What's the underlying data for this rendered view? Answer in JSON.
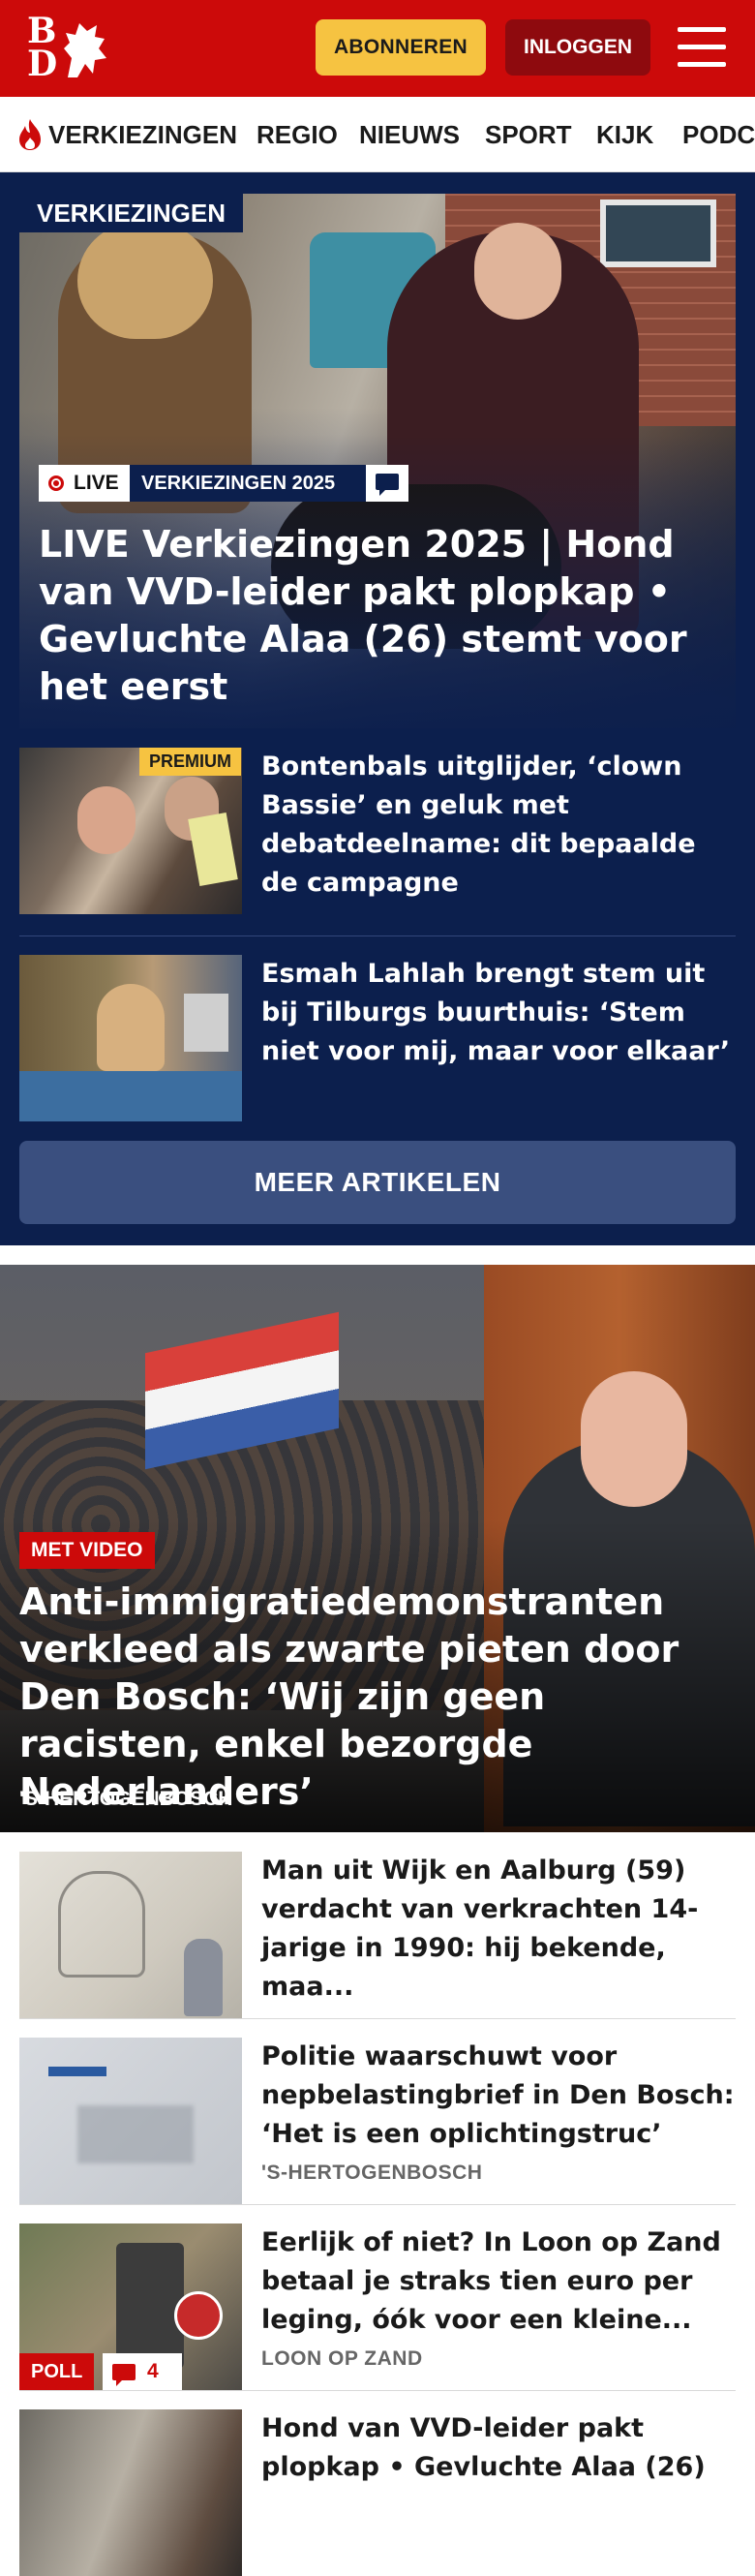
{
  "header": {
    "logo_letters": [
      "B",
      "D"
    ],
    "subscribe_label": "ABONNEREN",
    "login_label": "INLOGGEN",
    "menu_icon": "hamburger-menu-icon",
    "brand_red": "#cc0a0a",
    "accent_yellow": "#f6c341"
  },
  "nav": {
    "items": [
      "VERKIEZINGEN",
      "REGIO",
      "NIEUWS",
      "SPORT",
      "KIJK",
      "PODCASTS"
    ],
    "highlight_icon": "flame-icon"
  },
  "elections": {
    "section_label": "VERKIEZINGEN",
    "background": "#0c1f4d",
    "hero": {
      "live_label": "LIVE",
      "event_label": "VERKIEZINGEN 2025",
      "comment_icon": "comment-icon",
      "title": "LIVE Verkiezingen 2025 | Hond van VVD-leider pakt plopkap • Gevluchte Alaa (26) stemt voor het eerst"
    },
    "articles": [
      {
        "title": "Bontenbals uitglijder, ‘clown Bassie’ en geluk met debatdeelname: dit bepaalde de campagne",
        "badge": "PREMIUM"
      },
      {
        "title": "Esmah Lahlah brengt stem uit bij Tilburgs buurthuis: ‘Stem niet voor mij, maar voor elkaar’"
      }
    ],
    "more_label": "MEER ARTIKELEN"
  },
  "lead": {
    "tag": "MET VIDEO",
    "title": "Anti-immigratiedemonstranten verkleed als zwarte pieten door Den Bosch: ‘Wij zijn geen racisten, enkel bezorgde Nederlanders’",
    "location": "'S-HERTOGENBOSCH"
  },
  "list": [
    {
      "title": "Man uit Wijk en Aalburg (59) verdacht van verkrachten 14-jarige in 1990: hij bekende, maa...",
      "location": ""
    },
    {
      "title": "Politie waarschuwt voor nepbelastingbrief in Den Bosch: ‘Het is een oplichtingstruc’",
      "location": "'S-HERTOGENBOSCH"
    },
    {
      "title": "Eerlijk of niet? In Loon op Zand betaal je straks tien euro per leging, óók voor een kleine...",
      "location": "LOON OP ZAND",
      "tag": "POLL",
      "comments": "4"
    },
    {
      "title": "Hond van VVD-leider pakt plopkap • Gevluchte Alaa (26)",
      "location": ""
    }
  ]
}
